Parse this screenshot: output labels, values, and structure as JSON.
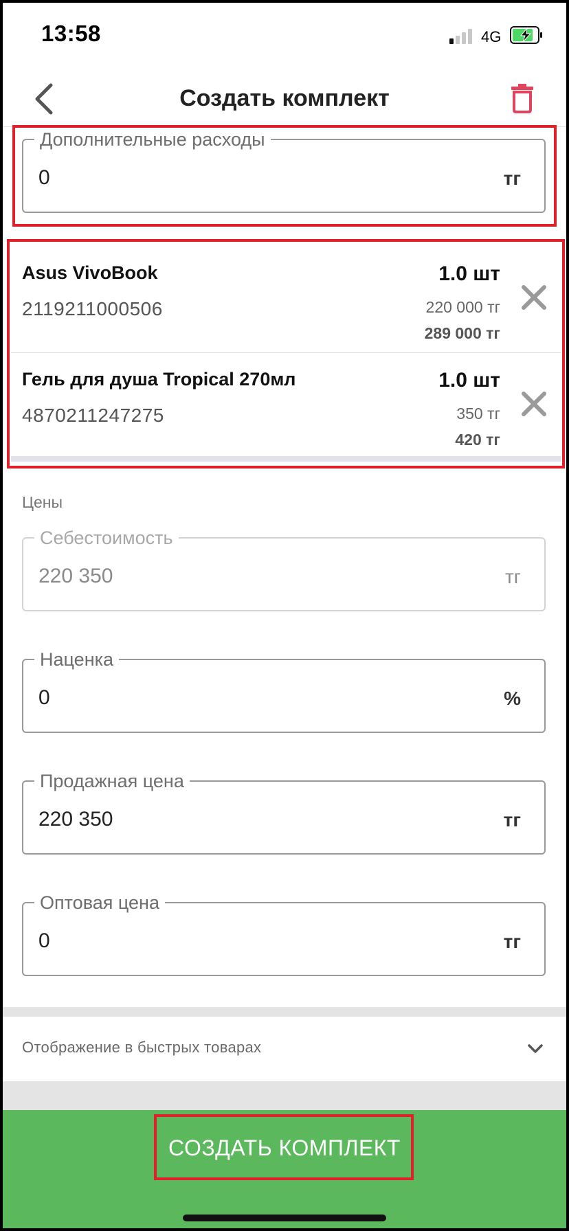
{
  "status_bar": {
    "time": "13:58",
    "network": "4G"
  },
  "nav": {
    "title": "Создать комплект"
  },
  "extra_costs": {
    "label": "Дополнительные расходы",
    "value": "0",
    "unit": "тг"
  },
  "products": [
    {
      "name": "Asus VivoBook",
      "code": "2119211000506",
      "qty": "1.0 шт",
      "cost": "220 000 тг",
      "price": "289 000 тг"
    },
    {
      "name": "Гель для душа Tropical 270мл",
      "code": "4870211247275",
      "qty": "1.0 шт",
      "cost": "350 тг",
      "price": "420 тг"
    }
  ],
  "prices_section": {
    "label": "Цены",
    "cost_price": {
      "label": "Себестоимость",
      "value": "220 350",
      "unit": "тг"
    },
    "markup": {
      "label": "Наценка",
      "value": "0",
      "unit": "%"
    },
    "sale_price": {
      "label": "Продажная цена",
      "value": "220 350",
      "unit": "тг"
    },
    "wholesale_price": {
      "label": "Оптовая цена",
      "value": "0",
      "unit": "тг"
    }
  },
  "quick_display": {
    "label": "Отображение в быстрых товарах"
  },
  "footer": {
    "create_button": "СОЗДАТЬ КОМПЛЕКТ"
  },
  "colors": {
    "accent_green": "#5cb85c",
    "delete_red": "#e0445e",
    "annotation_red": "#e0202b"
  }
}
